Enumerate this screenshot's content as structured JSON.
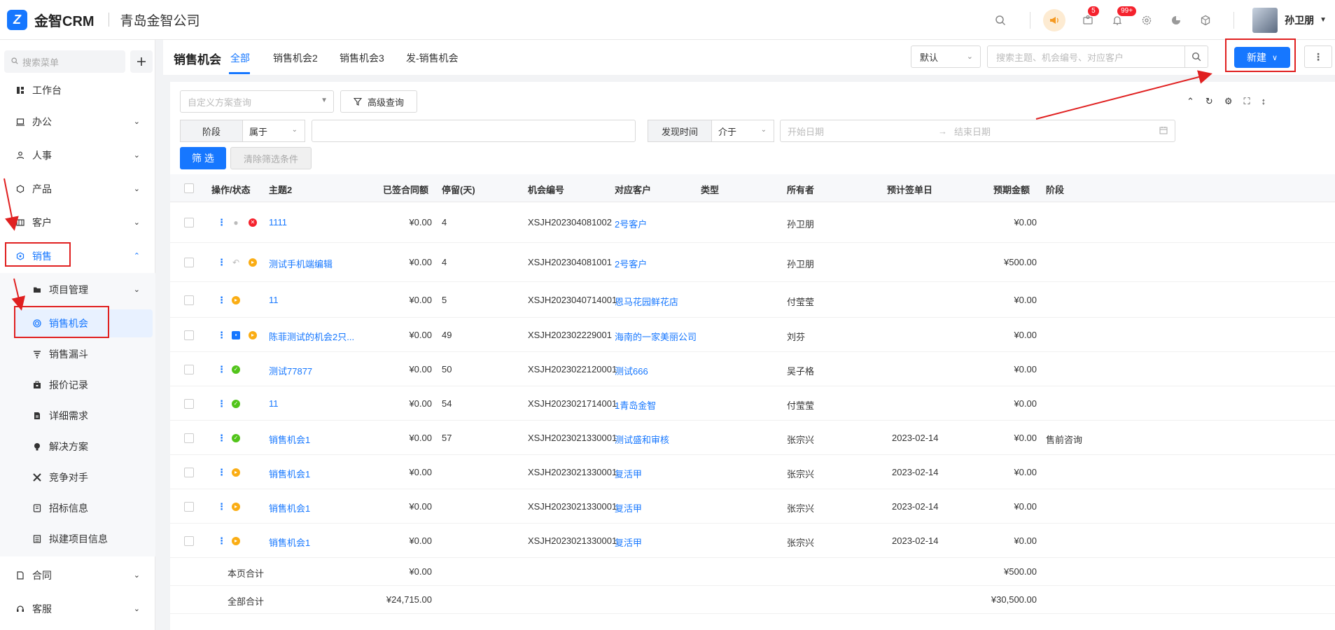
{
  "header": {
    "app_name": "金智CRM",
    "company": "青岛金智公司",
    "messages_badge": "5",
    "notifications_badge": "99+",
    "user_name": "孙卫朋"
  },
  "sidebar": {
    "search_placeholder": "搜索菜单",
    "items": [
      {
        "label": "工作台",
        "icon": "dashboard-icon"
      },
      {
        "label": "办公",
        "icon": "office-icon"
      },
      {
        "label": "人事",
        "icon": "people-icon"
      },
      {
        "label": "产品",
        "icon": "product-icon"
      },
      {
        "label": "客户",
        "icon": "customer-icon"
      },
      {
        "label": "销售",
        "icon": "sales-icon"
      },
      {
        "label": "合同",
        "icon": "contract-icon"
      },
      {
        "label": "客服",
        "icon": "service-icon"
      }
    ],
    "sub_items": [
      {
        "label": "项目管理",
        "icon": "folder-icon"
      },
      {
        "label": "销售机会",
        "icon": "opportunity-icon"
      },
      {
        "label": "销售漏斗",
        "icon": "funnel-icon"
      },
      {
        "label": "报价记录",
        "icon": "quote-icon"
      },
      {
        "label": "详细需求",
        "icon": "requirement-icon"
      },
      {
        "label": "解决方案",
        "icon": "solution-icon"
      },
      {
        "label": "竞争对手",
        "icon": "competitor-icon"
      },
      {
        "label": "招标信息",
        "icon": "bid-icon"
      },
      {
        "label": "拟建项目信息",
        "icon": "project-icon"
      }
    ]
  },
  "topbar": {
    "title": "销售机会",
    "tabs": [
      "全部",
      "销售机会2",
      "销售机会3",
      "发-销售机会"
    ],
    "view_select": "默认",
    "search_placeholder": "搜索主题、机会编号、对应客户",
    "new_button": "新建"
  },
  "filters": {
    "scheme_placeholder": "自定义方案查询",
    "advanced": "高级查询",
    "stage_label": "阶段",
    "stage_op": "属于",
    "found_time_label": "发现时间",
    "found_time_op": "介于",
    "start_date": "开始日期",
    "end_date": "结束日期",
    "filter_btn": "筛 选",
    "clear_btn": "清除筛选条件"
  },
  "table": {
    "columns": [
      "操作/状态",
      "主题2",
      "已签合同额",
      "停留(天)",
      "机会编号",
      "对应客户",
      "类型",
      "所有者",
      "预计签单日",
      "预期金额",
      "阶段"
    ],
    "rows": [
      {
        "subject": "1111",
        "signed": "¥0.00",
        "stay": "4",
        "code": "XSJH202304081002",
        "customer": "2号客户",
        "type": "",
        "owner": "孙卫朋",
        "date": "",
        "expected": "¥0.00",
        "stage": "",
        "status": [
          "gray-user",
          "red"
        ]
      },
      {
        "subject": "测试手机端编辑",
        "signed": "¥0.00",
        "stay": "4",
        "code": "XSJH202304081001",
        "customer": "2号客户",
        "type": "",
        "owner": "孙卫朋",
        "date": "",
        "expected": "¥500.00",
        "stage": "",
        "status": [
          "gray-undo",
          "yellow"
        ]
      },
      {
        "subject": "11",
        "signed": "¥0.00",
        "stay": "5",
        "code": "XSJH2023040714001",
        "customer": "恩马花园鲜花店",
        "type": "",
        "owner": "付莹莹",
        "date": "",
        "expected": "¥0.00",
        "stage": "",
        "status": [
          "yellow"
        ]
      },
      {
        "subject": "陈菲测试的机会2只...",
        "signed": "¥0.00",
        "stay": "49",
        "code": "XSJH202302229001",
        "customer": "海南的一家美丽公司",
        "type": "",
        "owner": "刘芬",
        "date": "",
        "expected": "¥0.00",
        "stage": "",
        "status": [
          "blue",
          "yellow"
        ]
      },
      {
        "subject": "测试77877",
        "signed": "¥0.00",
        "stay": "50",
        "code": "XSJH2023022120001",
        "customer": "测试666",
        "type": "",
        "owner": "吴子格",
        "date": "",
        "expected": "¥0.00",
        "stage": "",
        "status": [
          "green"
        ]
      },
      {
        "subject": "11",
        "signed": "¥0.00",
        "stay": "54",
        "code": "XSJH2023021714001",
        "customer": "1青岛金智",
        "type": "",
        "owner": "付莹莹",
        "date": "",
        "expected": "¥0.00",
        "stage": "",
        "status": [
          "green"
        ]
      },
      {
        "subject": "销售机会1",
        "signed": "¥0.00",
        "stay": "57",
        "code": "XSJH2023021330001",
        "customer": "测试盛和审核",
        "type": "",
        "owner": "张宗兴",
        "date": "2023-02-14",
        "expected": "¥0.00",
        "stage": "售前咨询",
        "status": [
          "green"
        ]
      },
      {
        "subject": "销售机会1",
        "signed": "¥0.00",
        "stay": "",
        "code": "XSJH2023021330001",
        "customer": "复活甲",
        "type": "",
        "owner": "张宗兴",
        "date": "2023-02-14",
        "expected": "¥0.00",
        "stage": "",
        "status": [
          "yellow"
        ]
      },
      {
        "subject": "销售机会1",
        "signed": "¥0.00",
        "stay": "",
        "code": "XSJH2023021330001",
        "customer": "复活甲",
        "type": "",
        "owner": "张宗兴",
        "date": "2023-02-14",
        "expected": "¥0.00",
        "stage": "",
        "status": [
          "yellow"
        ]
      },
      {
        "subject": "销售机会1",
        "signed": "¥0.00",
        "stay": "",
        "code": "XSJH2023021330001",
        "customer": "复活甲",
        "type": "",
        "owner": "张宗兴",
        "date": "2023-02-14",
        "expected": "¥0.00",
        "stage": "",
        "status": [
          "yellow"
        ]
      }
    ],
    "page_total": {
      "label": "本页合计",
      "signed": "¥0.00",
      "expected": "¥500.00"
    },
    "all_total": {
      "label": "全部合计",
      "signed": "¥24,715.00",
      "expected": "¥30,500.00"
    }
  },
  "colors": {
    "accent": "#1677ff",
    "annotation": "#e02020"
  }
}
